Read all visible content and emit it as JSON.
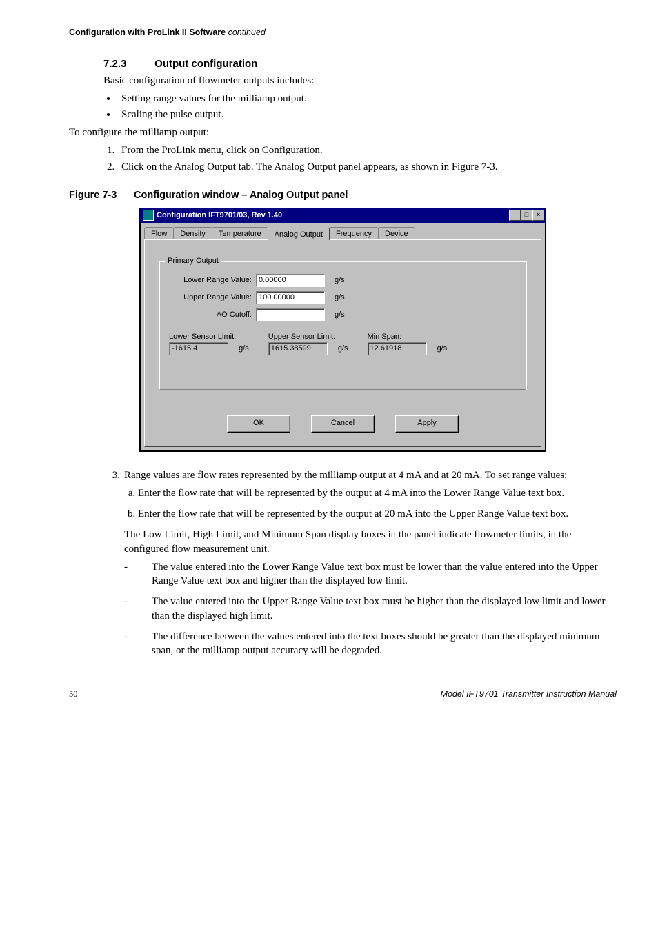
{
  "header": {
    "title": "Configuration with ProLink II Software",
    "continued": "continued"
  },
  "section": {
    "number": "7.2.3",
    "title": "Output configuration"
  },
  "intro": "Basic configuration of flowmeter outputs includes:",
  "bullets": [
    "Setting range values for the milliamp output.",
    "Scaling the pulse output."
  ],
  "lead2": "To configure the milliamp output:",
  "steps12": [
    "From the ProLink menu, click on Configuration.",
    "Click on the Analog Output tab. The Analog Output panel appears, as shown in Figure 7-3."
  ],
  "figure": {
    "number": "Figure 7-3",
    "caption": "Configuration window – Analog Output panel"
  },
  "window": {
    "title": "Configuration IFT9701/03, Rev 1.40",
    "tabs": [
      "Flow",
      "Density",
      "Temperature",
      "Analog Output",
      "Frequency",
      "Device"
    ],
    "active_tab_index": 3,
    "group_legend": "Primary Output",
    "lrv_label": "Lower Range Value:",
    "lrv_value": "0.00000",
    "urv_label": "Upper Range Value:",
    "urv_value": "100.00000",
    "ao_label": "AO Cutoff:",
    "ao_value": "",
    "unit": "g/s",
    "lsl_label": "Lower Sensor Limit:",
    "lsl_value": "-1615.4",
    "usl_label": "Upper Sensor Limit:",
    "usl_value": "1615.38599",
    "ms_label": "Min Span:",
    "ms_value": "12.61918",
    "buttons": {
      "ok": "OK",
      "cancel": "Cancel",
      "apply": "Apply"
    },
    "window_controls": {
      "min": "_",
      "max": "□",
      "close": "×"
    }
  },
  "step3": {
    "num": "3.",
    "text": "Range values are flow rates represented by the milliamp output at 4 mA and at 20 mA. To set range values:",
    "subs": [
      "Enter the flow rate that will be represented by the output at 4 mA into the Lower Range Value text box.",
      "Enter the flow rate that will be represented by the output at 20 mA into the Upper Range Value text box."
    ],
    "limits_intro": "The Low Limit, High Limit, and Minimum Span display boxes in the panel indicate flowmeter limits, in the configured flow measurement unit.",
    "dashes": [
      "The value entered into the Lower Range Value text box must be lower than the value entered into the Upper Range Value text box and higher than the displayed low limit.",
      "The value entered into the Upper Range Value text box must be higher than the displayed low limit and lower than the displayed high limit.",
      "The difference between the values entered into the text boxes should be greater than the displayed minimum span, or the milliamp output accuracy will be degraded."
    ]
  },
  "footer": {
    "page": "50",
    "manual": "Model IFT9701 Transmitter Instruction Manual"
  }
}
